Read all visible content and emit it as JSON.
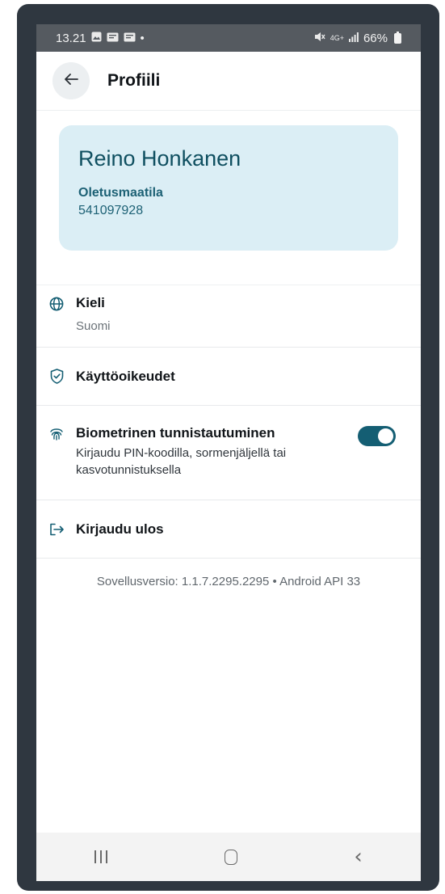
{
  "status_bar": {
    "time": "13.21",
    "left_icons": [
      "image-icon",
      "message-icon",
      "message-icon"
    ],
    "dot": "•",
    "right_icons": [
      "mute-icon",
      "signal-4g-icon",
      "signal-icon"
    ],
    "signal_label": "4G+",
    "battery_text": "66%",
    "battery_level": 0.66
  },
  "app_bar": {
    "back_icon": "arrow-left-icon",
    "title": "Profiili"
  },
  "profile_card": {
    "name": "Reino Honkanen",
    "farm": "Oletusmaatila",
    "id": "541097928"
  },
  "settings": {
    "language": {
      "icon": "globe-icon",
      "title": "Kieli",
      "value": "Suomi"
    },
    "rights": {
      "icon": "shield-check-icon",
      "title": "Käyttöoikeudet"
    },
    "biometric": {
      "icon": "fingerprint-icon",
      "title": "Biometrinen tunnistautuminen",
      "description": "Kirjaudu PIN-koodilla, sormenjäljellä tai kasvotunnistuksella",
      "enabled": true
    },
    "logout": {
      "icon": "logout-icon",
      "title": "Kirjaudu ulos"
    }
  },
  "version_text": "Sovellusversio: 1.1.7.2295.2295 • Android API 33",
  "colors": {
    "accent": "#145e73",
    "card_bg": "#dbeef5",
    "card_text": "#0f4f60",
    "frame": "#2f3740"
  },
  "nav_bar": [
    "recent-apps-icon",
    "home-icon",
    "back-icon"
  ]
}
